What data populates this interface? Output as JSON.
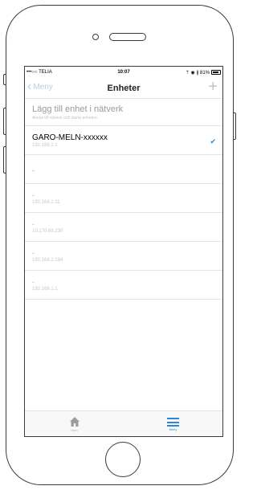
{
  "status_bar": {
    "carrier": "•••○○ TELIA",
    "time": "10:07",
    "indicators": "⇡ ◉ ∦ 81%"
  },
  "nav": {
    "back_label": "Meny",
    "title": "Enheter",
    "add_label": "+"
  },
  "add_device": {
    "title": "Lägg till enhet i nätverk",
    "subtitle": "Anslut till nätverk och starta enheten"
  },
  "devices": [
    {
      "name": "GARO-MELN-xxxxxx",
      "ip": "192.168.2.1",
      "selected": true
    },
    {
      "name": "-",
      "ip": ""
    },
    {
      "name": "-",
      "ip": "192.168.1.11"
    },
    {
      "name": "-",
      "ip": "10.170.68.230"
    },
    {
      "name": "-",
      "ip": "192.168.1.184"
    },
    {
      "name": "-",
      "ip": "192.168.1.1"
    }
  ],
  "tabs": {
    "home_label": "Hem",
    "menu_label": "Meny"
  },
  "colors": {
    "accent": "#2f85d8",
    "muted": "#c4c4c4",
    "back_link": "#b7cfe8"
  }
}
